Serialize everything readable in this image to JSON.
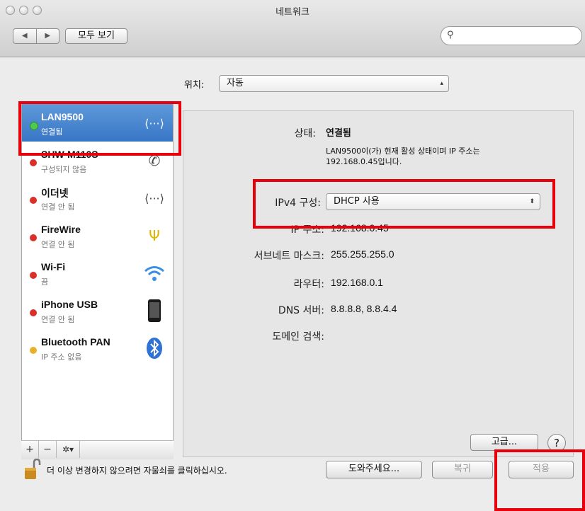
{
  "window": {
    "title": "네트워크"
  },
  "toolbar": {
    "back": "◀",
    "forward": "▶",
    "show_all": "모두 보기",
    "search_placeholder": ""
  },
  "location": {
    "label": "위치:",
    "value": "자동"
  },
  "services": [
    {
      "name": "LAN9500",
      "status": "연결됨",
      "dot": "#3fbf3f",
      "icon": "ethernet-icon"
    },
    {
      "name": "SHW-M110S",
      "status": "구성되지 않음",
      "dot": "#d9302a",
      "icon": "phone-modem-icon"
    },
    {
      "name": "이더넷",
      "status": "연결 안 됨",
      "dot": "#d9302a",
      "icon": "ethernet-icon"
    },
    {
      "name": "FireWire",
      "status": "연결 안 됨",
      "dot": "#d9302a",
      "icon": "firewire-icon"
    },
    {
      "name": "Wi-Fi",
      "status": "끔",
      "dot": "#d9302a",
      "icon": "wifi-icon"
    },
    {
      "name": "iPhone USB",
      "status": "연결 안 됨",
      "dot": "#d9302a",
      "icon": "iphone-icon"
    },
    {
      "name": "Bluetooth PAN",
      "status": "IP 주소 없음",
      "dot": "#e7b22b",
      "icon": "bluetooth-icon"
    }
  ],
  "sidebar_tools": {
    "add": "+",
    "remove": "−",
    "action": "✲▾"
  },
  "detail": {
    "status_label": "상태:",
    "status_value": "연결됨",
    "status_desc_1": "LAN9500이(가) 현재 활성 상태이며 IP 주소는",
    "status_desc_2": "192.168.0.45입니다.",
    "ipv4_label": "IPv4 구성:",
    "ipv4_value": "DHCP 사용",
    "ip_label": "IP 주소:",
    "ip_value": "192.168.0.45",
    "subnet_label": "서브네트 마스크:",
    "subnet_value": "255.255.255.0",
    "router_label": "라우터:",
    "router_value": "192.168.0.1",
    "dns_label": "DNS 서버:",
    "dns_value": "8.8.8.8, 8.8.4.4",
    "domain_label": "도메인 검색:",
    "advanced": "고급...",
    "help": "?"
  },
  "footer": {
    "lock_text": "더 이상 변경하지 않으려면 자물쇠를 클릭하십시오.",
    "assist": "도와주세요...",
    "revert": "복귀",
    "apply": "적용"
  },
  "colors": {
    "highlight": "#e8000b",
    "selection": "#3875c6"
  }
}
